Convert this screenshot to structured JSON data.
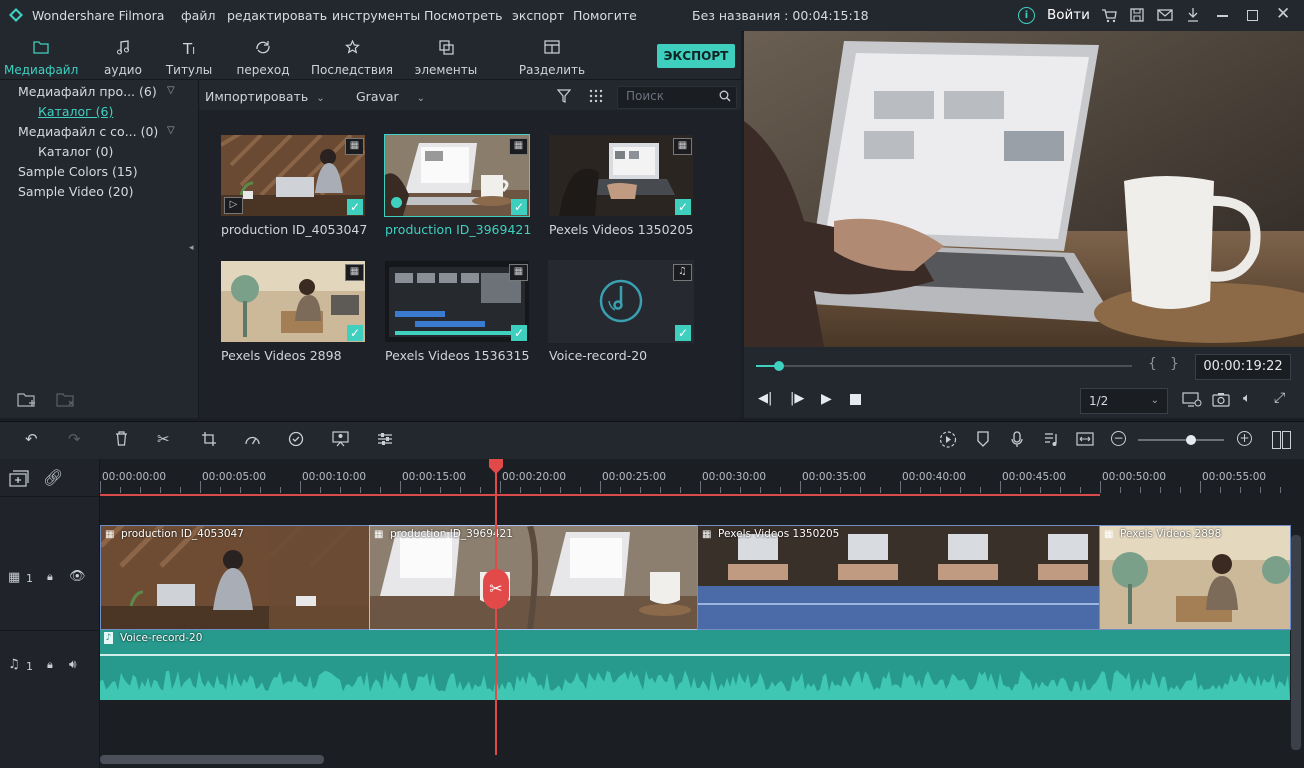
{
  "titlebar": {
    "app_name": "Wondershare Filmora",
    "menu": [
      "файл",
      "редактировать",
      "инструменты",
      "Посмотреть",
      "экспорт",
      "Помогите"
    ],
    "project_title": "Без названия : 00:04:15:18",
    "login_label": "Войти"
  },
  "media_tabs": [
    {
      "label": "Медиафайл",
      "icon": "folder-icon",
      "active": true
    },
    {
      "label": "аудио",
      "icon": "music-note-icon"
    },
    {
      "label": "Титулы",
      "icon": "text-icon"
    },
    {
      "label": "переход",
      "icon": "transition-icon"
    },
    {
      "label": "Последствия",
      "icon": "effects-icon"
    },
    {
      "label": "элементы",
      "icon": "elements-icon"
    },
    {
      "label": "Разделить экран",
      "icon": "split-screen-icon"
    }
  ],
  "export_label": "ЭКСПОРТ",
  "library": [
    {
      "label": "Медиафайл про... (6)"
    },
    {
      "label": "Каталог (6)"
    },
    {
      "label": "Медиафайл с со... (0)"
    },
    {
      "label": "Каталог (0)"
    },
    {
      "label": "Sample Colors (15)"
    },
    {
      "label": "Sample Video (20)"
    }
  ],
  "browser": {
    "import_label": "Импортировать",
    "record_label": "Gravar",
    "search_placeholder": "Поиск"
  },
  "media_items": [
    {
      "label": "production ID_4053047",
      "type": "video",
      "selected": false
    },
    {
      "label": "production ID_3969421",
      "type": "video",
      "selected": true
    },
    {
      "label": "Pexels Videos 1350205",
      "type": "video",
      "selected": false
    },
    {
      "label": "Pexels Videos 2898",
      "type": "video",
      "selected": false
    },
    {
      "label": "Pexels Videos 1536315",
      "type": "video",
      "selected": false
    },
    {
      "label": "Voice-record-20",
      "type": "audio",
      "selected": false
    }
  ],
  "preview": {
    "timecode": "00:00:19:22",
    "ratio": "1/2",
    "progress": 0.06
  },
  "ruler_ticks": [
    "00:00:00:00",
    "00:00:05:00",
    "00:00:10:00",
    "00:00:15:00",
    "00:00:20:00",
    "00:00:25:00",
    "00:00:30:00",
    "00:00:35:00",
    "00:00:40:00",
    "00:00:45:00",
    "00:00:50:00",
    "00:00:55:00"
  ],
  "tracks": {
    "video_label": "1",
    "audio_label": "1"
  },
  "video_clips": [
    {
      "label": "production ID_4053047"
    },
    {
      "label": "production ID_3969421"
    },
    {
      "label": "Pexels Videos 1350205"
    },
    {
      "label": "Pexels Videos 2898"
    }
  ],
  "audio_clip": {
    "label": "Voice-record-20"
  }
}
